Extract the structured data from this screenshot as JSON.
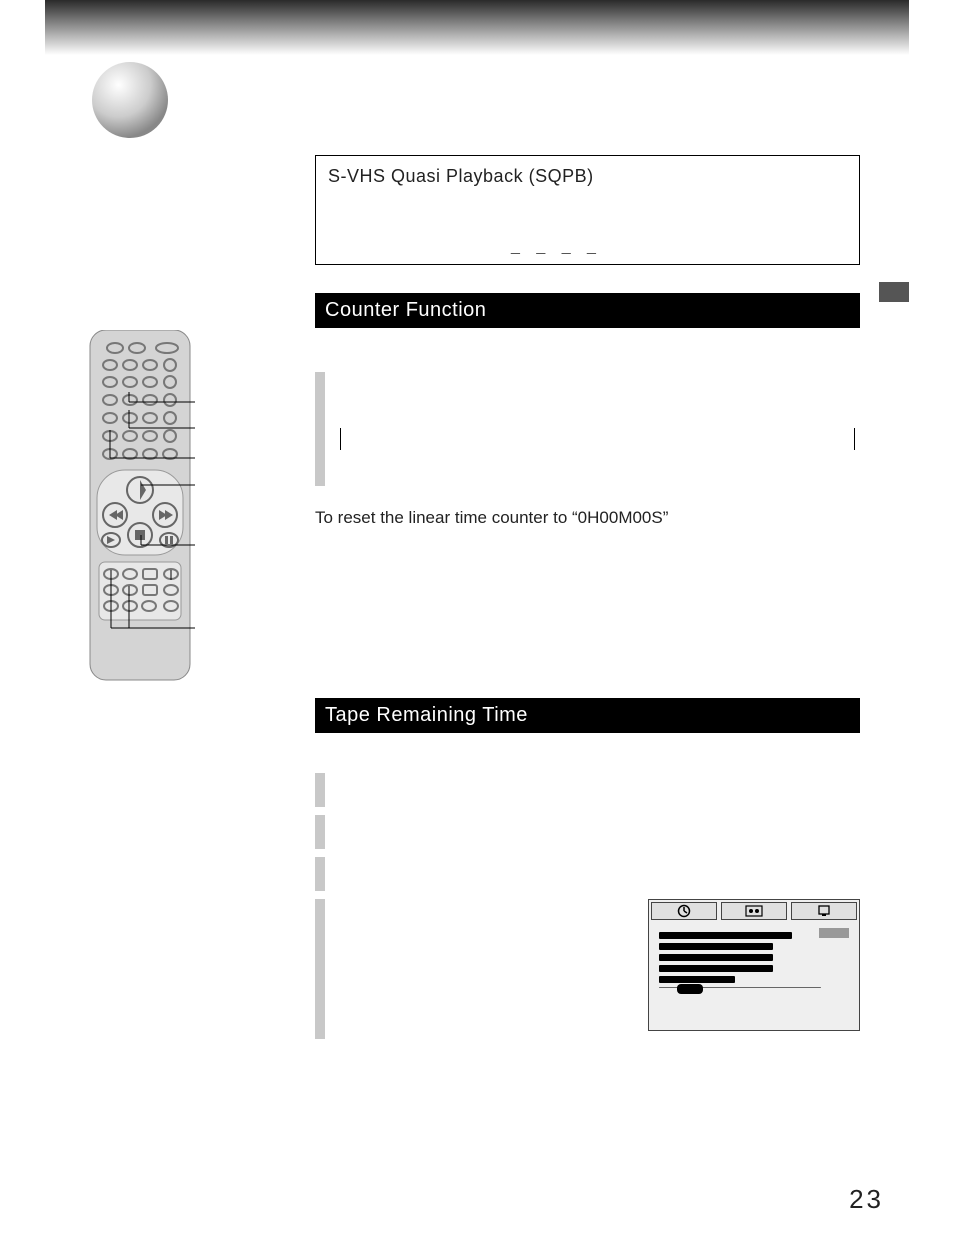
{
  "sqpb": {
    "title": "S-VHS Quasi Playback (SQPB)",
    "dashes": "_  _  _  _"
  },
  "sections": {
    "counter": {
      "heading": "Counter Function",
      "reset_line": "To reset the linear time counter to “0H00M00S”"
    },
    "tape": {
      "heading": "Tape Remaining Time"
    }
  },
  "page_number": "23"
}
